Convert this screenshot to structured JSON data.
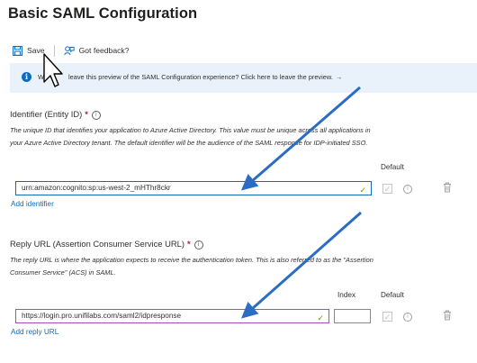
{
  "page": {
    "title": "Basic SAML Configuration"
  },
  "toolbar": {
    "save_label": "Save",
    "feedback_label": "Got feedback?"
  },
  "infobar": {
    "prefix": "W",
    "text": "leave this preview of the SAML Configuration experience? Click here to leave the preview."
  },
  "identifier": {
    "label": "Identifier (Entity ID)",
    "required_mark": "*",
    "info_glyph": "i",
    "desc_line1": "The unique ID that identifies your application to Azure Active Directory. This value must be unique across all applications in",
    "desc_line2": "your Azure Active Directory tenant. The default identifier will be the audience of the SAML response for IDP-initiated SSO.",
    "default_header": "Default",
    "value": "urn:amazon:cognito:sp:us-west-2_mHThr8ckr",
    "add_link": "Add identifier"
  },
  "reply": {
    "label": "Reply URL (Assertion Consumer Service URL)",
    "required_mark": "*",
    "info_glyph": "i",
    "desc_line1": "The reply URL is where the application expects to receive the authentication token. This is also referred to as the \"Assertion",
    "desc_line2": "Consumer Service\" (ACS) in SAML.",
    "index_header": "Index",
    "default_header": "Default",
    "value": "https://login.pro.unifilabs.com/saml2/idpresponse",
    "index_value": "",
    "add_link": "Add reply URL"
  },
  "glyphs": {
    "check": "✓",
    "info": "i",
    "info_icon": "i"
  },
  "colors": {
    "accent": "#0f6cbd",
    "annotation_arrow": "#2b6cc4",
    "identifier_border": "#0f6cbd",
    "reply_border": "#a34dbf",
    "valid_check": "#57a300",
    "required": "#a4262c"
  },
  "icons": [
    "save-icon",
    "feedback-icon",
    "info-icon",
    "checkbox",
    "info-circle-icon",
    "trash-icon",
    "mouse-cursor",
    "annotation-arrow"
  ]
}
